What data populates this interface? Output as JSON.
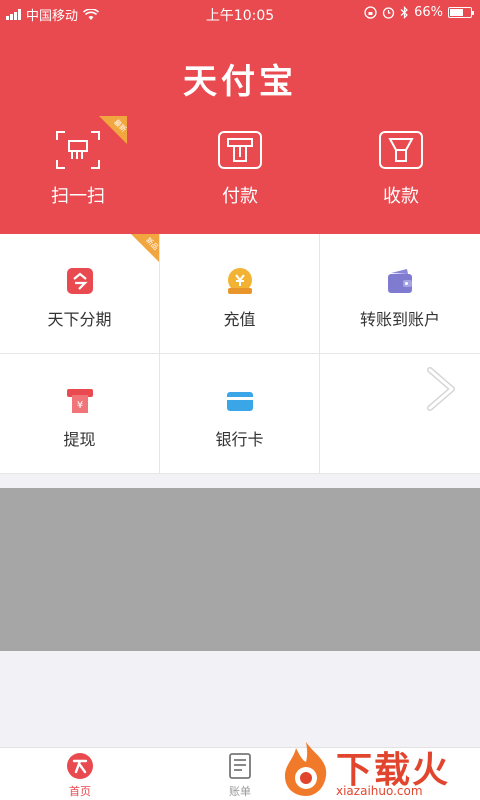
{
  "status_bar": {
    "carrier": "中国移动",
    "time": "上午10:05",
    "battery_text": "66%",
    "battery_level": 0.66
  },
  "header": {
    "title": "天付宝",
    "actions": [
      {
        "label": "扫一扫",
        "icon": "scan-icon",
        "badge": "最新"
      },
      {
        "label": "付款",
        "icon": "pay-icon"
      },
      {
        "label": "收款",
        "icon": "receive-icon"
      }
    ]
  },
  "services": [
    {
      "label": "天下分期",
      "icon": "installment-icon",
      "badge": "新品"
    },
    {
      "label": "充值",
      "icon": "recharge-icon"
    },
    {
      "label": "转账到账户",
      "icon": "wallet-transfer-icon"
    },
    {
      "label": "提现",
      "icon": "withdraw-icon"
    },
    {
      "label": "银行卡",
      "icon": "bank-card-icon"
    }
  ],
  "tabbar": {
    "tabs": [
      {
        "label": "首页",
        "icon": "home-icon",
        "active": true
      },
      {
        "label": "账单",
        "icon": "bill-icon",
        "active": false
      }
    ]
  },
  "watermark": {
    "text": "下载火",
    "sub": "xiazaihuo.com"
  },
  "colors": {
    "brand_red": "#e84a4f",
    "badge_orange": "#f2a63f",
    "banner_gray": "#a6a6a6"
  }
}
